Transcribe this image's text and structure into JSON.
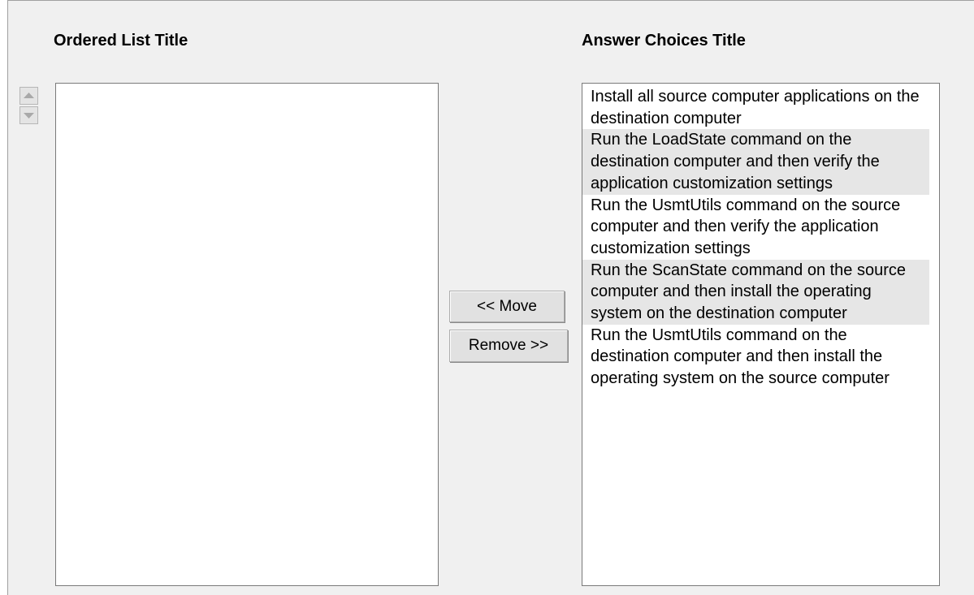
{
  "ordered_list": {
    "title": "Ordered List Title",
    "items": []
  },
  "answer_choices": {
    "title": "Answer Choices Title",
    "items": [
      "Install all source computer applications on the destination computer",
      "Run the LoadState command on the destination computer and then verify the application customization settings",
      "Run the UsmtUtils command on the source computer and then verify the application customization settings",
      "Run the ScanState command on the source computer and then install the operating system on the destination computer",
      "Run the UsmtUtils command on the destination computer and then install the operating system on the source computer"
    ]
  },
  "buttons": {
    "move_label": "<< Move",
    "remove_label": "Remove >>"
  },
  "icons": {
    "up": "arrow-up-icon",
    "down": "arrow-down-icon"
  }
}
